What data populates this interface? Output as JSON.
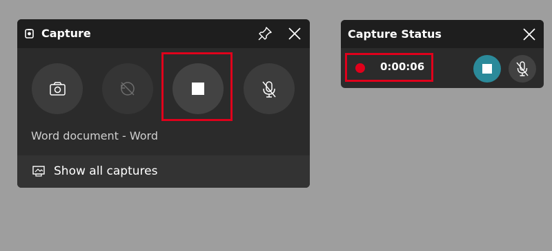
{
  "capture_widget": {
    "title": "Capture",
    "icon": "capture-widget-icon",
    "buttons": [
      {
        "name": "take-screenshot",
        "icon": "camera-icon",
        "enabled": true
      },
      {
        "name": "record-last-30-seconds",
        "icon": "record-last-icon",
        "enabled": false
      },
      {
        "name": "stop-recording",
        "icon": "stop-icon",
        "enabled": true,
        "highlighted": true
      },
      {
        "name": "microphone-toggle",
        "icon": "mic-off-icon",
        "enabled": true
      }
    ],
    "app_name": "Word document - Word",
    "show_captures_label": "Show all captures",
    "colors": {
      "header_bg": "#1e1e1e",
      "panel_bg": "#2b2b2b",
      "highlight": "#e0001b"
    }
  },
  "status_widget": {
    "title": "Capture Status",
    "recording_indicator_color": "#e0001b",
    "timer": "0:00:06",
    "stop_button_color": "#2b8a9a",
    "mic_icon": "mic-off-icon"
  }
}
